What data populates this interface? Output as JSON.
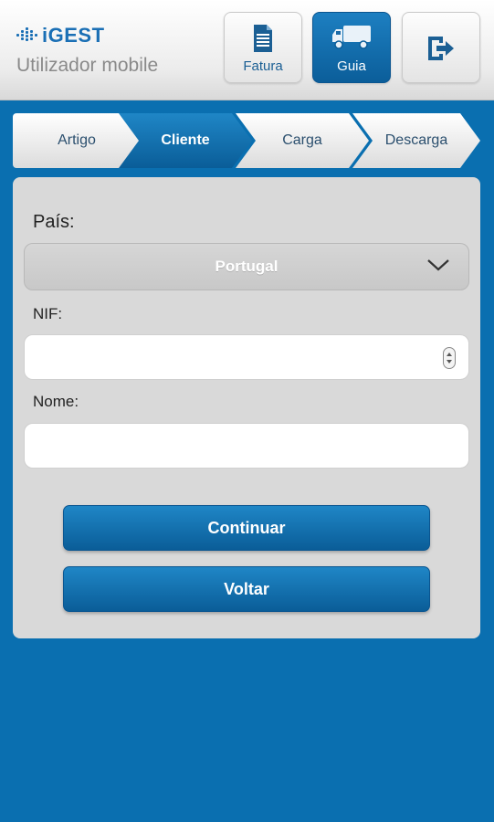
{
  "header": {
    "logo_text": "iGEST",
    "user_label": "Utilizador mobile",
    "buttons": [
      {
        "label": "Fatura",
        "icon": "document-icon"
      },
      {
        "label": "Guia",
        "icon": "truck-icon",
        "active": true
      },
      {
        "label": "",
        "icon": "logout-icon"
      }
    ]
  },
  "steps": [
    "Artigo",
    "Cliente",
    "Carga",
    "Descarga"
  ],
  "active_step": "Cliente",
  "form": {
    "country_label": "País:",
    "country_value": "Portugal",
    "nif_label": "NIF:",
    "nif_value": "",
    "name_label": "Nome:",
    "name_value": ""
  },
  "actions": {
    "continue_label": "Continuar",
    "back_label": "Voltar"
  },
  "colors": {
    "background": "#0a6fb0",
    "accent": "#0b5e9a",
    "panel": "#d9d9d9"
  }
}
